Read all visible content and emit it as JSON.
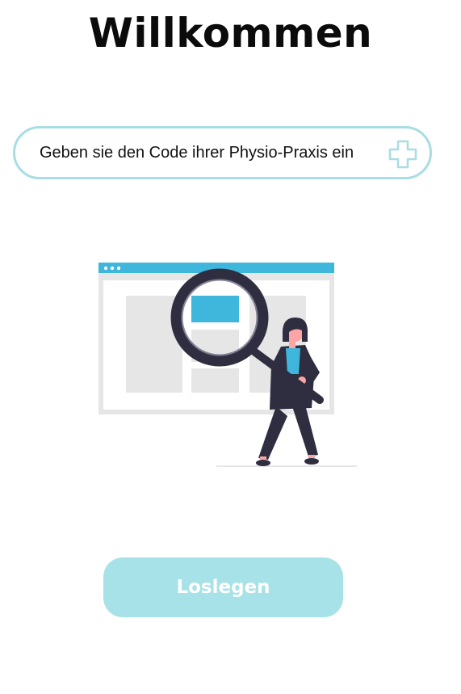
{
  "header": {
    "title": "Willkommen"
  },
  "code_field": {
    "placeholder": "Geben sie den Code ihrer Physio-Praxis ein",
    "value": "",
    "icon": "medical-cross-icon"
  },
  "illustration": {
    "icon": "search-illustration"
  },
  "actions": {
    "start_label": "Loslegen"
  },
  "colors": {
    "accent": "#a6e2e7",
    "field_border": "#a7dde3",
    "illustration_blue": "#3fb6dc",
    "illustration_dark": "#2f2e41"
  }
}
